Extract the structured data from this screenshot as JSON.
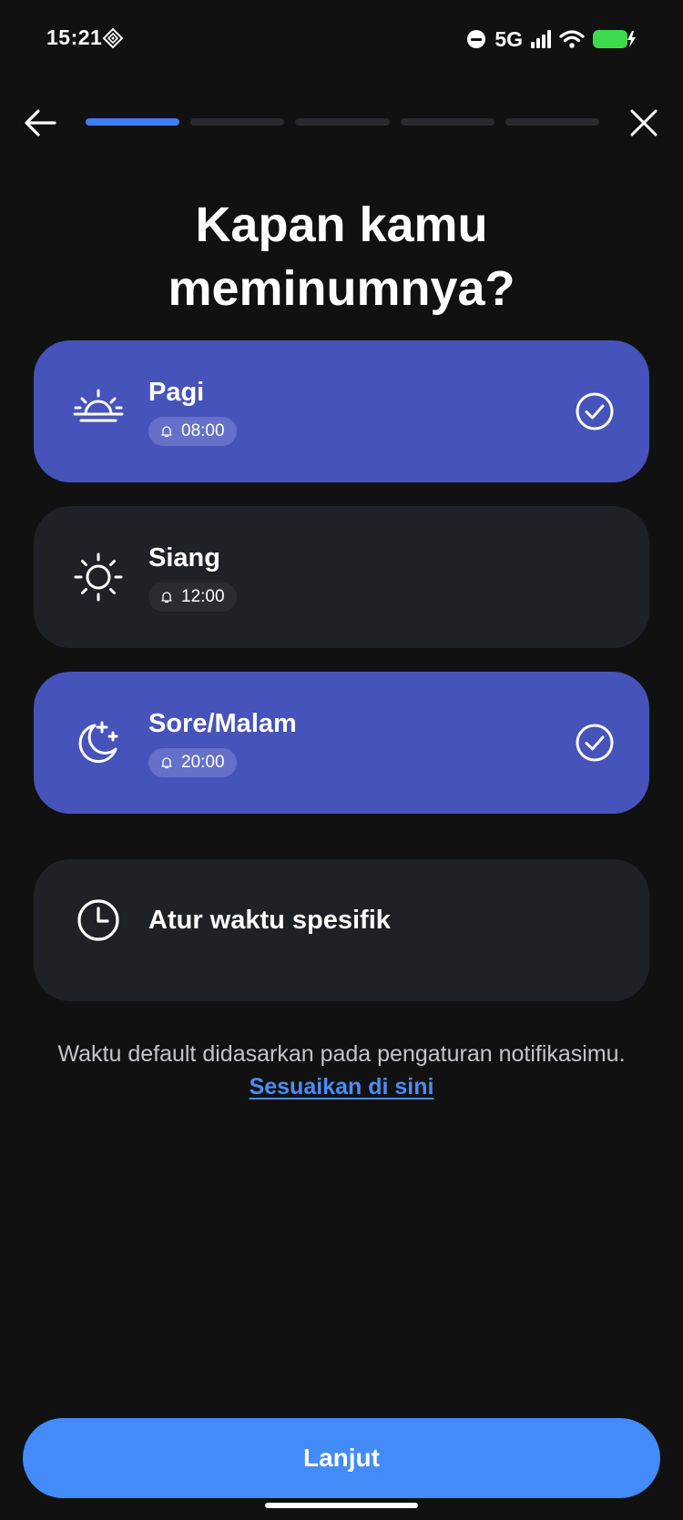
{
  "status_bar": {
    "time": "15:21",
    "network": "5G",
    "battery_color": "#3ddc4f"
  },
  "nav": {
    "back_icon": "arrow-left-icon",
    "close_icon": "close-icon",
    "progress": {
      "total_steps": 5,
      "current_step": 1
    }
  },
  "title": "Kapan kamu\nmeminumnya?",
  "options": [
    {
      "title": "Pagi",
      "time": "08:00",
      "icon": "sunrise-icon",
      "selected": true
    },
    {
      "title": "Siang",
      "time": "12:00",
      "icon": "sun-icon",
      "selected": false
    },
    {
      "title": "Sore/Malam",
      "time": "20:00",
      "icon": "moon-stars-icon",
      "selected": true
    }
  ],
  "custom_option": {
    "title": "Atur waktu spesifik",
    "icon": "clock-icon"
  },
  "helper": {
    "text": "Waktu default didasarkan pada pengaturan notifikasimu.",
    "link": "Sesuaikan di sini"
  },
  "primary_button": {
    "label": "Lanjut"
  },
  "colors": {
    "background": "#111112",
    "card": "#202027",
    "card_selected": "#4653bb",
    "accent": "#428bf9",
    "link": "#4a8df5"
  }
}
